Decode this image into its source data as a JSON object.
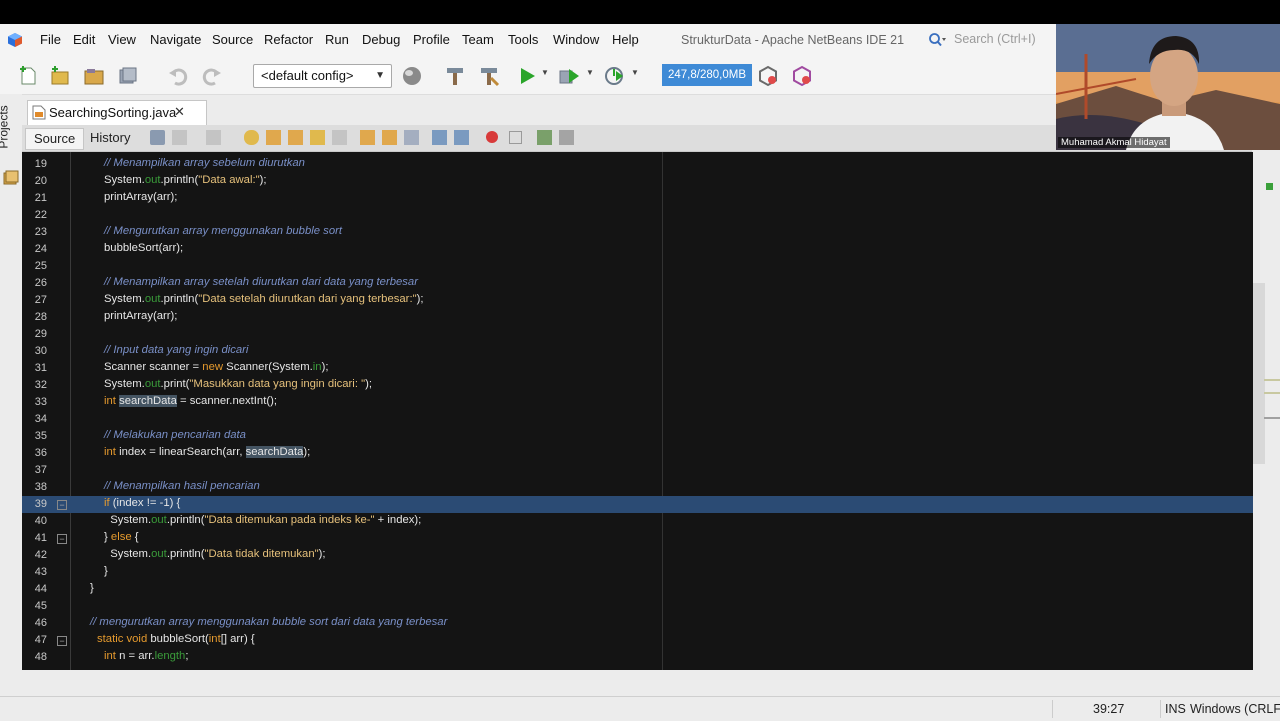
{
  "menu": [
    "File",
    "Edit",
    "View",
    "Navigate",
    "Source",
    "Refactor",
    "Run",
    "Debug",
    "Profile",
    "Team",
    "Tools",
    "Window",
    "Help"
  ],
  "window_title": "StrukturData - Apache NetBeans IDE 21",
  "search_placeholder": "Search (Ctrl+I)",
  "toolbar": {
    "config": "<default config>",
    "memory": "247,8/280,0MB"
  },
  "side_tab": "Projects",
  "file_tab": "SearchingSorting.java",
  "editor_tabs": [
    "Source",
    "History"
  ],
  "code_lines": [
    {
      "n": "19",
      "html": "<span class=\"cm\">// Menampilkan array sebelum diurutkan</span>"
    },
    {
      "n": "20",
      "html": "System.<span class=\"fd\">out</span>.println(<span class=\"st\">\"Data awal:\"</span>);"
    },
    {
      "n": "21",
      "html": "printArray(arr);"
    },
    {
      "n": "22",
      "html": ""
    },
    {
      "n": "23",
      "html": "<span class=\"cm\">// Mengurutkan array menggunakan bubble sort</span>"
    },
    {
      "n": "24",
      "html": "bubbleSort(arr);"
    },
    {
      "n": "25",
      "html": ""
    },
    {
      "n": "26",
      "html": "<span class=\"cm\">// Menampilkan array setelah diurutkan dari data yang terbesar</span>"
    },
    {
      "n": "27",
      "html": "System.<span class=\"fd\">out</span>.println(<span class=\"st\">\"Data setelah diurutkan dari yang terbesar:\"</span>);"
    },
    {
      "n": "28",
      "html": "printArray(arr);"
    },
    {
      "n": "29",
      "html": ""
    },
    {
      "n": "30",
      "html": "<span class=\"cm\">// Input data yang ingin dicari</span>"
    },
    {
      "n": "31",
      "html": "Scanner scanner = <span class=\"kw\">new</span> Scanner(System.<span class=\"fd\">in</span>);"
    },
    {
      "n": "32",
      "html": "System.<span class=\"fd\">out</span>.print(<span class=\"st\">\"Masukkan data yang ingin dicari: \"</span>);"
    },
    {
      "n": "33",
      "html": "<span class=\"kw\">int</span> <span class=\"mk\">searchData</span> = scanner.nextInt();"
    },
    {
      "n": "34",
      "html": ""
    },
    {
      "n": "35",
      "html": "<span class=\"cm\">// Melakukan pencarian data</span>"
    },
    {
      "n": "36",
      "html": "<span class=\"kw\">int</span> index = linearSearch(arr, <span class=\"mk\">searchData</span>);"
    },
    {
      "n": "37",
      "html": ""
    },
    {
      "n": "38",
      "html": "<span class=\"cm\">// Menampilkan hasil pencarian</span>"
    },
    {
      "n": "39",
      "html": "<span class=\"kw\">if</span> (index != -1) {",
      "hl": true
    },
    {
      "n": "40",
      "html": "  System.<span class=\"fd\">out</span>.println(<span class=\"st\">\"Data ditemukan pada indeks ke-\"</span> + index);"
    },
    {
      "n": "41",
      "html": "} <span class=\"kw\">else</span> {"
    },
    {
      "n": "42",
      "html": "  System.<span class=\"fd\">out</span>.println(<span class=\"st\">\"Data tidak ditemukan\"</span>);"
    },
    {
      "n": "43",
      "html": "}"
    },
    {
      "n": "44",
      "html": "}",
      "indent": -2
    },
    {
      "n": "45",
      "html": ""
    },
    {
      "n": "46",
      "html": "<span class=\"cm\">// mengurutkan array menggunakan bubble sort dari data yang terbesar</span>",
      "indent": -2
    },
    {
      "n": "47",
      "html": "<span class=\"kw\">static void</span> bubbleSort(<span class=\"kw\">int</span>[] arr) {",
      "indent": -1
    },
    {
      "n": "48",
      "html": "<span class=\"kw\">int</span> n = arr.<span class=\"fd\">length</span>;"
    }
  ],
  "status": {
    "position": "39:27",
    "mode": "INS",
    "line_ending": "Windows (CRLF)"
  },
  "webcam_name": "Muhamad Akmal Hidayat"
}
